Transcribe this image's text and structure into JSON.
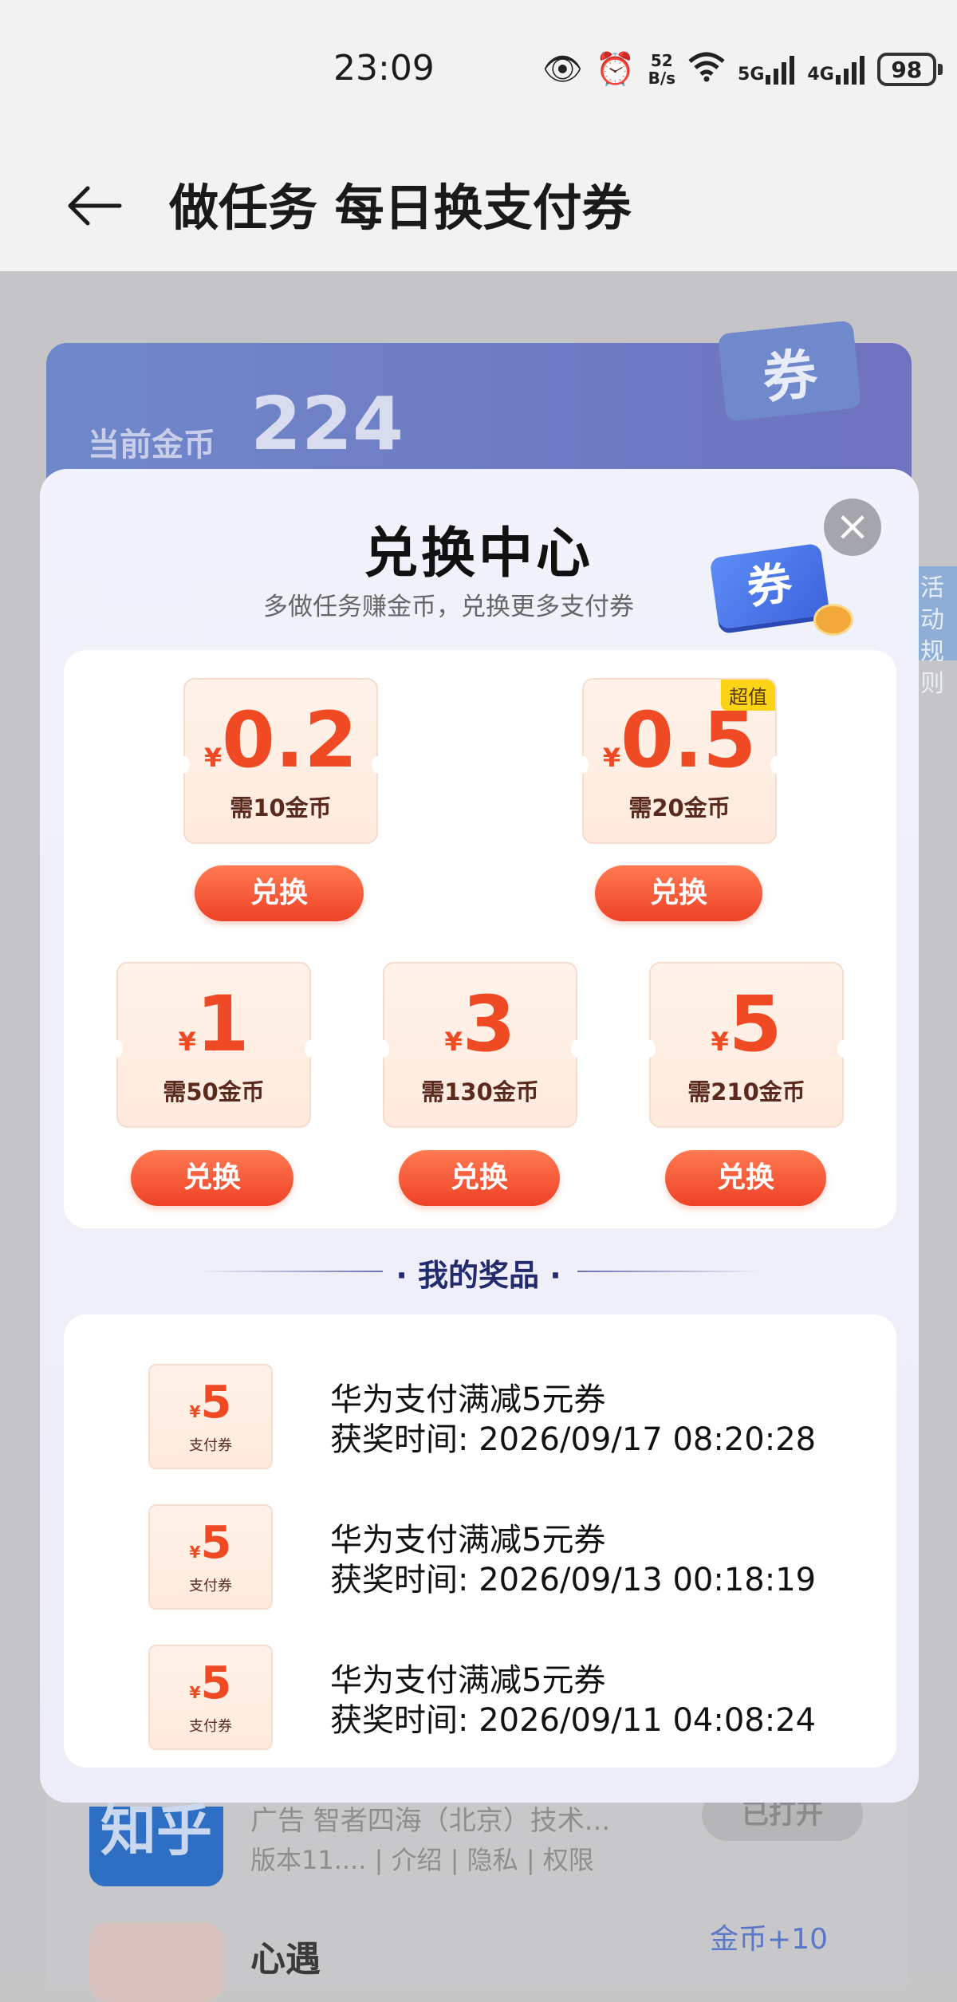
{
  "status": {
    "time": "23:09",
    "net_speed": "52\nB/s",
    "net_speed_top": "52",
    "net_speed_bottom": "B/s",
    "sig1": "5G",
    "sig2": "4G",
    "battery": "98"
  },
  "header": {
    "title": "做任务 每日换支付券"
  },
  "background": {
    "coin_label": "当前金币",
    "coin_value": "224",
    "quan": "券",
    "rules": "活动规则",
    "zhihu": "知乎",
    "ad_line": "广告 智者四海（北京）技术...",
    "version_line": "版本11.... | 介绍 | 隐私 | 权限",
    "opened_button": "已打开",
    "app2_name": "心遇",
    "coin_plus": "金币+10"
  },
  "modal": {
    "title": "兑换中心",
    "subtitle": "多做任务赚金币，兑换更多支付券",
    "quan_icon": "券",
    "close_icon": "close-icon",
    "yen": "¥",
    "exchange_label": "兑换",
    "vouchers": [
      {
        "amount": "0.2",
        "need": "需10金币",
        "tag": ""
      },
      {
        "amount": "0.5",
        "need": "需20金币",
        "tag": "超值"
      },
      {
        "amount": "1",
        "need": "需50金币",
        "tag": ""
      },
      {
        "amount": "3",
        "need": "需130金币",
        "tag": ""
      },
      {
        "amount": "5",
        "need": "需210金币",
        "tag": ""
      }
    ],
    "prizes_title": "· 我的奖品 ·",
    "prizes": [
      {
        "amount": "5",
        "label": "支付券",
        "name": "华为支付满减5元券",
        "time": "获奖时间: 2026/09/17 08:20:28"
      },
      {
        "amount": "5",
        "label": "支付券",
        "name": "华为支付满减5元券",
        "time": "获奖时间: 2026/09/13 00:18:19"
      },
      {
        "amount": "5",
        "label": "支付券",
        "name": "华为支付满减5元券",
        "time": "获奖时间: 2026/09/11 04:08:24"
      }
    ]
  },
  "colors": {
    "accent": "#f04a25",
    "button": "#ee4126",
    "title_blue": "#232a6e",
    "tag": "#fbd317"
  }
}
